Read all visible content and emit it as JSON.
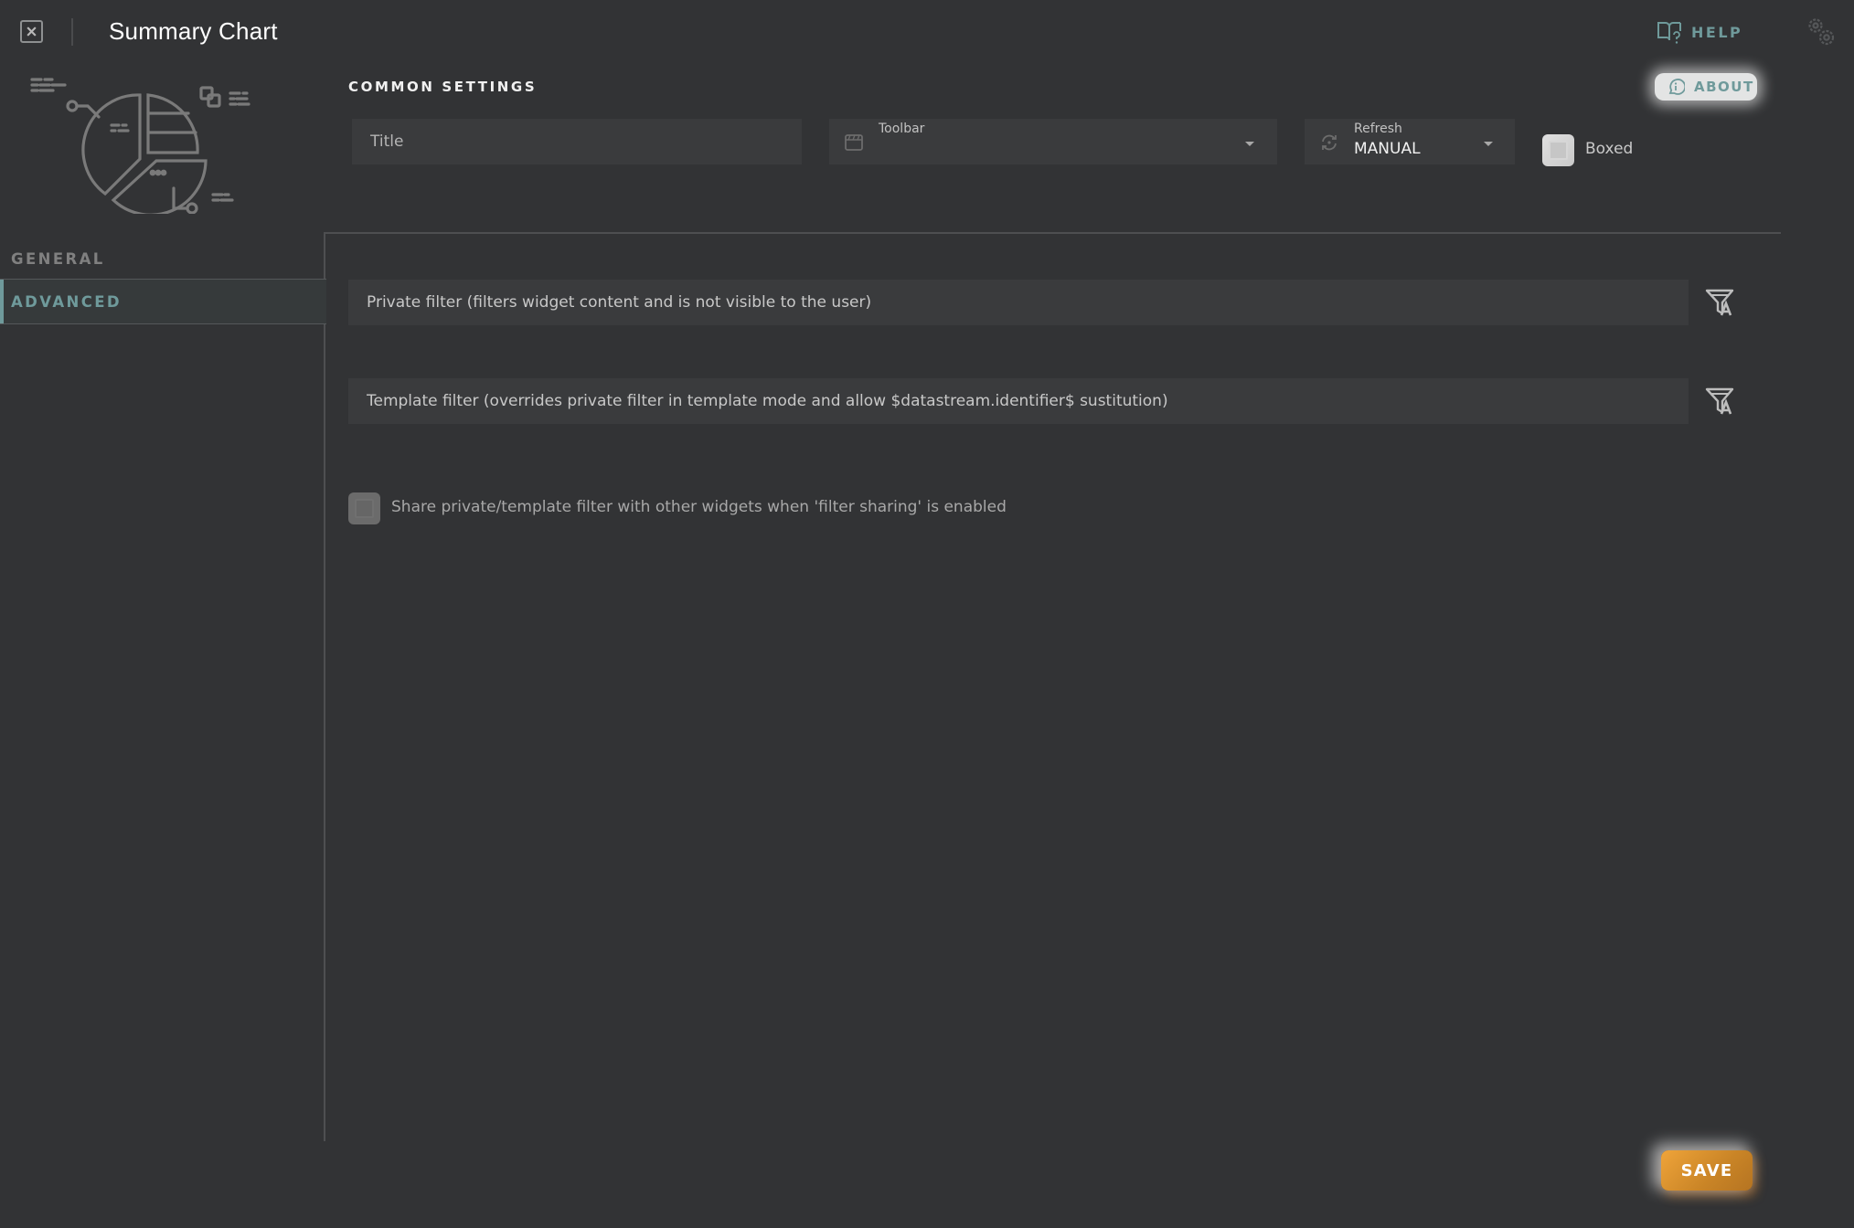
{
  "header": {
    "title": "Summary Chart",
    "help_label": "HELP",
    "icons": {
      "close": "close-icon",
      "help": "book-question-icon",
      "settings": "gears-icon"
    }
  },
  "common_settings": {
    "heading": "COMMON SETTINGS",
    "about_label": "ABOUT",
    "title_field": {
      "placeholder": "Title",
      "value": ""
    },
    "toolbar_select": {
      "label": "Toolbar",
      "value": ""
    },
    "refresh_select": {
      "label": "Refresh",
      "value": "MANUAL"
    },
    "boxed": {
      "label": "Boxed",
      "checked": false
    }
  },
  "sidebar": {
    "items": [
      {
        "label": "GENERAL",
        "active": false
      },
      {
        "label": "ADVANCED",
        "active": true
      }
    ]
  },
  "advanced": {
    "private_filter": {
      "placeholder": "Private filter (filters widget content and is not visible to the user)",
      "value": ""
    },
    "template_filter": {
      "placeholder": "Template filter (overrides private filter in template mode and allow $datastream.identifier$ sustitution)",
      "value": ""
    },
    "share_filter": {
      "label": "Share private/template filter with other widgets when 'filter sharing' is enabled",
      "checked": false
    }
  },
  "footer": {
    "save_label": "SAVE"
  },
  "colors": {
    "background": "#323335",
    "field": "#3a3b3d",
    "accent_teal": "#6f9a9b",
    "save_orange": "#e09a34"
  }
}
